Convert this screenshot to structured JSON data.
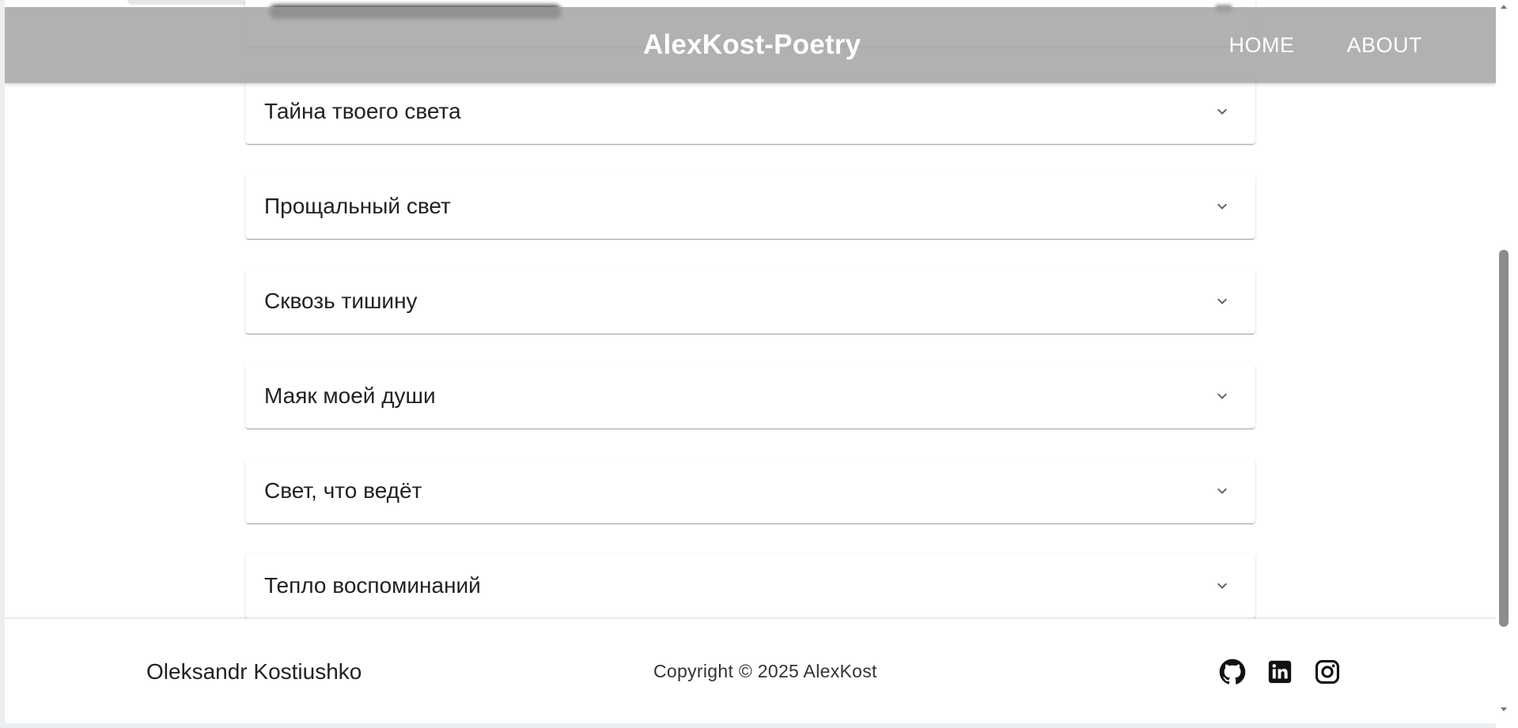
{
  "header": {
    "brand": "AlexKost-Poetry",
    "nav": [
      {
        "label": "HOME"
      },
      {
        "label": "ABOUT"
      }
    ]
  },
  "poems": [
    {
      "title": "Тайна твоего света"
    },
    {
      "title": "Прощальный свет"
    },
    {
      "title": "Сквозь тишину"
    },
    {
      "title": "Маяк моей души"
    },
    {
      "title": "Свет, что ведёт"
    },
    {
      "title": "Тепло воспоминаний"
    }
  ],
  "footer": {
    "author": "Oleksandr Kostiushko",
    "copyright": "Copyright © 2025 AlexKost",
    "social": [
      {
        "icon": "github-icon"
      },
      {
        "icon": "linkedin-icon"
      },
      {
        "icon": "instagram-icon"
      }
    ]
  },
  "colors": {
    "header_bg": "#a0a0a0",
    "header_text": "#ffffff",
    "card_bg": "#ffffff",
    "text": "#222222"
  }
}
